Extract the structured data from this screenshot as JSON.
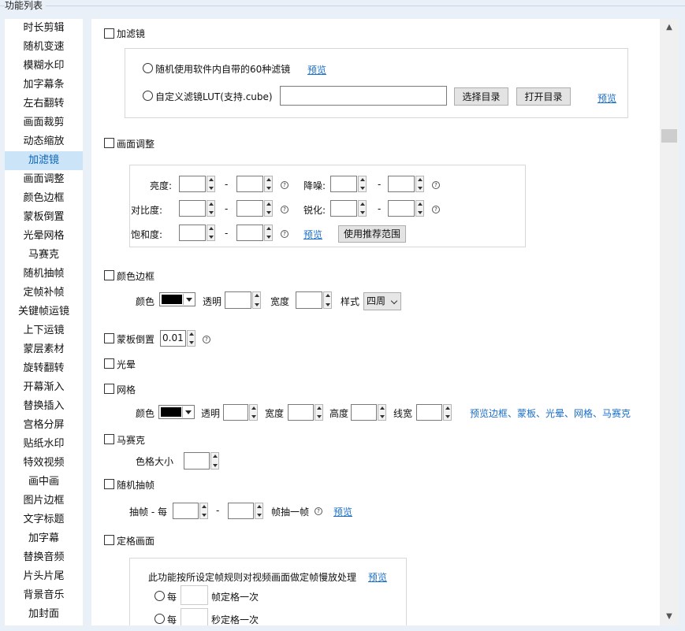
{
  "group_title": "功能列表",
  "sidebar": {
    "active_index": 7,
    "items": [
      "时长剪辑",
      "随机变速",
      "模糊水印",
      "加字幕条",
      "左右翻转",
      "画面裁剪",
      "动态缩放",
      "加滤镜",
      "画面调整",
      "颜色边框",
      "蒙板倒置",
      "光晕网格",
      "马赛克",
      "随机抽帧",
      "定帧补帧",
      "关键帧运镜",
      "上下运镜",
      "蒙层素材",
      "旋转翻转",
      "开幕渐入",
      "替换插入",
      "宫格分屏",
      "贴纸水印",
      "特效视频",
      "画中画",
      "图片边框",
      "文字标题",
      "加字幕",
      "替换音频",
      "片头片尾",
      "背景音乐",
      "加封面"
    ]
  },
  "filter": {
    "label": "加滤镜",
    "opt_random": "随机使用软件内自带的60种滤镜",
    "preview1": "预览",
    "opt_lut": "自定义滤镜LUT(支持.cube)",
    "lut_path": "",
    "choose_dir": "选择目录",
    "open_dir": "打开目录",
    "preview2": "预览"
  },
  "adjust": {
    "label": "画面调整",
    "brightness": "亮度:",
    "contrast": "对比度:",
    "saturation": "饱和度:",
    "denoise": "降噪:",
    "sharpen": "锐化:",
    "dash": "-",
    "help": "?",
    "preview": "预览",
    "recommend": "使用推荐范围"
  },
  "border": {
    "label": "颜色边框",
    "color": "颜色",
    "alpha": "透明",
    "width": "宽度",
    "style": "样式",
    "style_value": "四周",
    "swatch_color": "#000000"
  },
  "mask": {
    "label": "蒙板倒置",
    "value": "0.01"
  },
  "glow": {
    "label": "光晕"
  },
  "grid": {
    "label": "网格",
    "color": "颜色",
    "alpha": "透明",
    "width": "宽度",
    "height": "高度",
    "line": "线宽",
    "preview": "预览边框、蒙板、光晕、网格、马赛克"
  },
  "mosaic": {
    "label": "马赛克",
    "cell": "色格大小"
  },
  "drop": {
    "label": "随机抽帧",
    "prefix": "抽帧 - 每",
    "suffix": "帧抽一帧",
    "preview": "预览"
  },
  "freeze": {
    "label": "定格画面",
    "desc": "此功能按所设定帧规则对视频画面做定帧慢放处理",
    "preview": "预览",
    "every": "每",
    "per_frame": "帧定格一次",
    "per_second": "秒定格一次"
  }
}
